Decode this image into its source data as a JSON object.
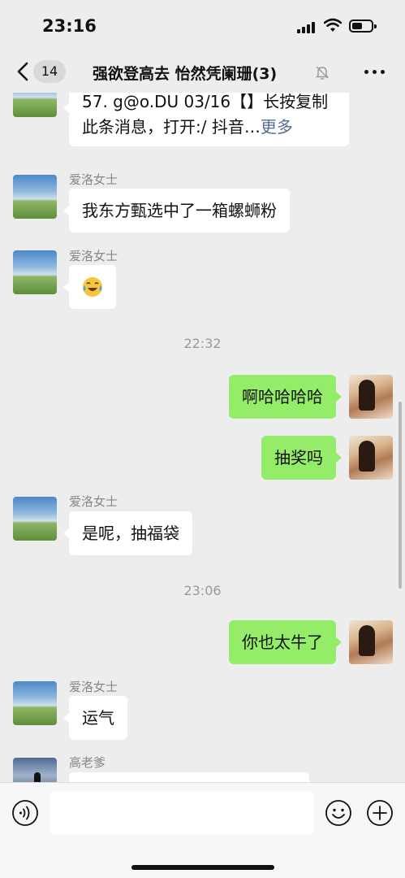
{
  "status_bar": {
    "time": "23:16",
    "icons": [
      "cellular-signal-icon",
      "wifi-icon",
      "battery-icon"
    ],
    "battery_level": 0.55
  },
  "navbar": {
    "back_icon": "chevron-left-icon",
    "unread_count": "14",
    "title": "强欲登高去 怡然凭阑珊(3)",
    "mute_icon": "bell-slash-icon",
    "more_icon": "ellipsis-icon"
  },
  "messages": {
    "m0_text_line1": "57. g@o.DU 03/16【】长按复制",
    "m0_text_line2": "此条消息，打开:/ 抖音…",
    "m0_more": "更多",
    "m1_sender": "爱洛女士",
    "m1_text": "我东方甄选中了一箱螺蛳粉",
    "m2_sender": "爱洛女士",
    "m2_emoji": "laughing-tears-emoji",
    "ts1": "22:32",
    "m3_text": "啊哈哈哈哈",
    "m4_text": "抽奖吗",
    "m5_sender": "爱洛女士",
    "m5_text": "是呢，抽福袋",
    "ts2": "23:06",
    "m6_text": "你也太牛了",
    "m7_sender": "爱洛女士",
    "m7_text": "运气",
    "m8_sender": "高老爹"
  },
  "input_bar": {
    "voice_icon": "voice-icon",
    "value": "",
    "emoji_icon": "smiley-icon",
    "plus_icon": "plus-icon"
  },
  "colors": {
    "background": "#ededed",
    "outgoing_bubble": "#95ec69",
    "incoming_bubble": "#ffffff",
    "link": "#576b95"
  }
}
